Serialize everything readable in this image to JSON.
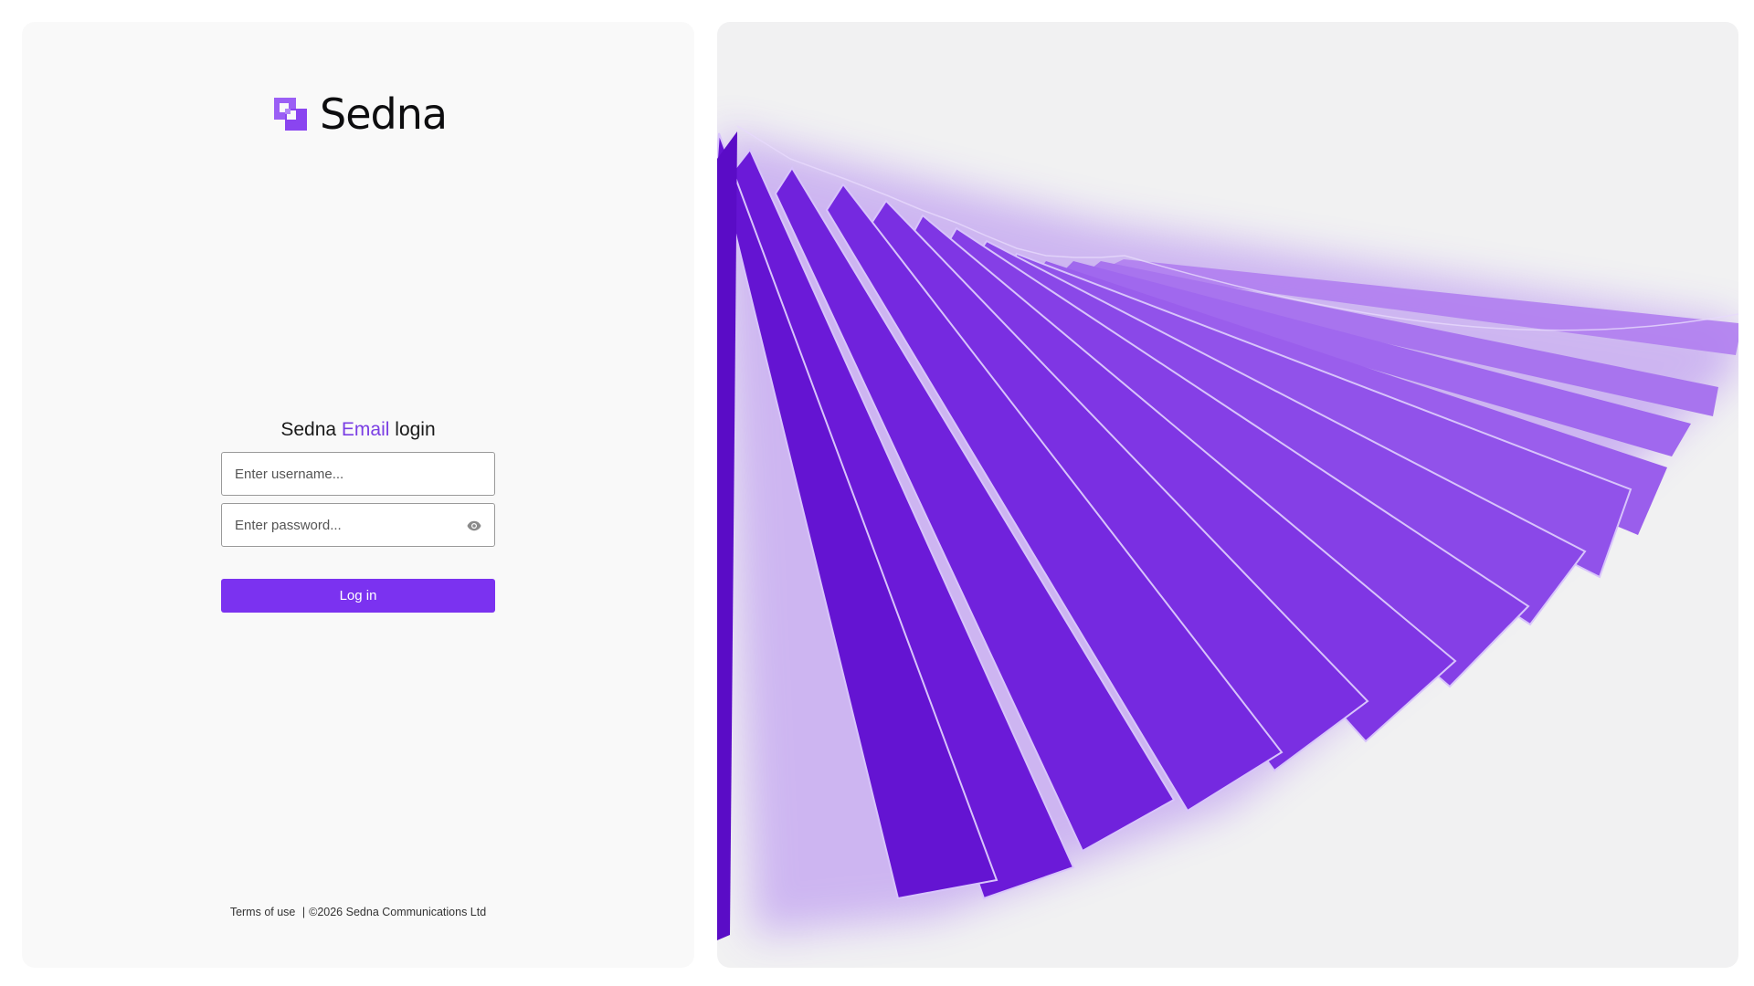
{
  "brand": {
    "name": "Sedna",
    "accent_color": "#7b32f0",
    "logo_icon": "sedna-logo-icon"
  },
  "login": {
    "heading_prefix": "Sedna",
    "heading_accent": "Email",
    "heading_suffix": "login",
    "username_placeholder": "Enter username...",
    "password_placeholder": "Enter password...",
    "show_password_icon": "eye-icon",
    "submit_label": "Log in"
  },
  "footer": {
    "terms_label": "Terms of use",
    "separator": "|",
    "copyright": "©2026",
    "company": "Sedna Communications Ltd"
  },
  "hero": {
    "description_icon": "purple-fan-ribbon-artwork"
  }
}
